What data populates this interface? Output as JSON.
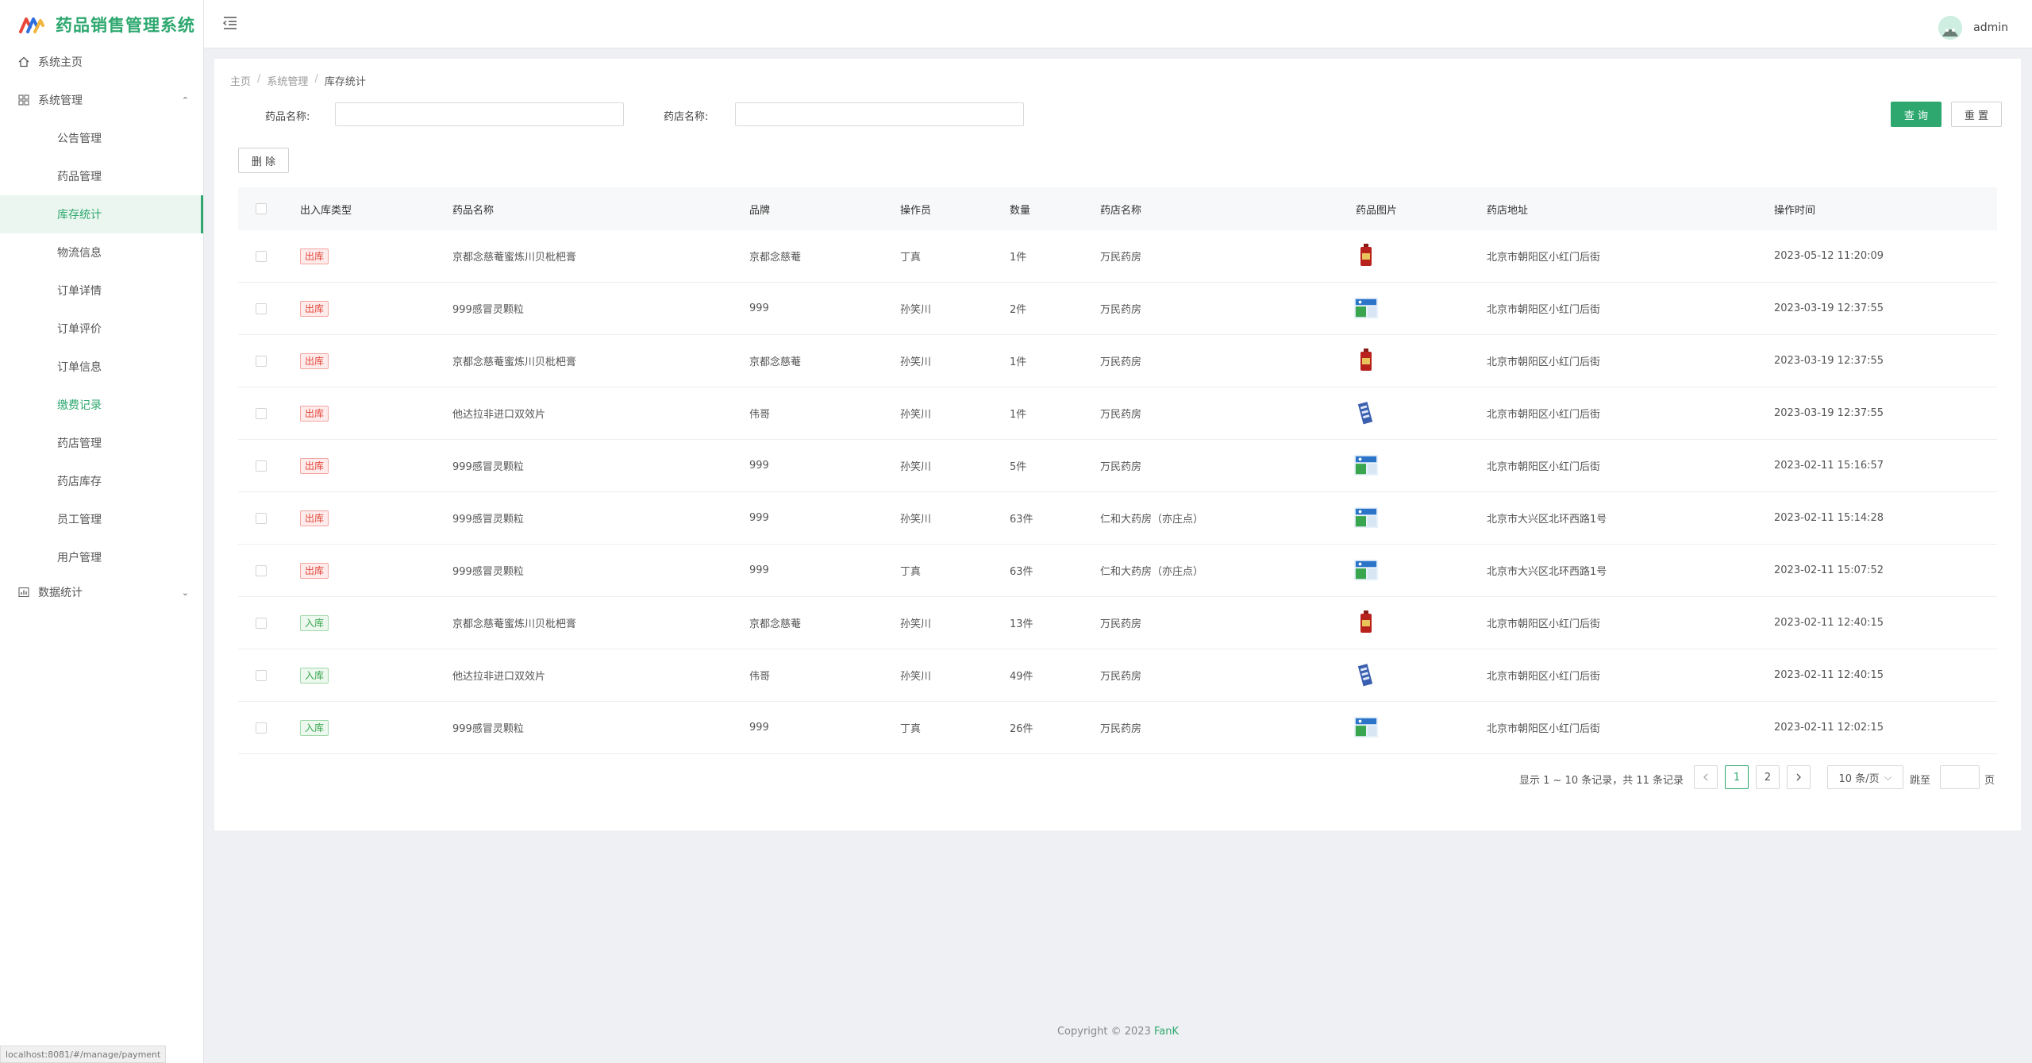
{
  "app": {
    "title": "药品销售管理系统",
    "brand_color": "#2ea86f"
  },
  "sidebar": {
    "home": "系统主页",
    "system": "系统管理",
    "sub_items": [
      "公告管理",
      "药品管理",
      "库存统计",
      "物流信息",
      "订单详情",
      "订单评价",
      "订单信息",
      "缴费记录",
      "药店管理",
      "药店库存",
      "员工管理",
      "用户管理"
    ],
    "active_item": "库存统计",
    "stats": "数据统计"
  },
  "header": {
    "username": "admin"
  },
  "breadcrumb": [
    "主页",
    "系统管理",
    "库存统计"
  ],
  "search": {
    "drug_label": "药品名称:",
    "drug_value": "",
    "store_label": "药店名称:",
    "store_value": "",
    "query_btn": "查 询",
    "reset_btn": "重 置"
  },
  "toolbar": {
    "delete_btn": "删 除"
  },
  "table": {
    "columns": [
      "出入库类型",
      "药品名称",
      "品牌",
      "操作员",
      "数量",
      "药店名称",
      "药品图片",
      "药店地址",
      "操作时间"
    ],
    "rows": [
      {
        "type": "出库",
        "kind": "out",
        "drug": "京都念慈菴蜜炼川贝枇杷膏",
        "brand": "京都念慈菴",
        "operator": "丁真",
        "qty": "1件",
        "store": "万民药房",
        "img": "red-bottle-icon",
        "address": "北京市朝阳区小红门后街",
        "time": "2023-05-12 11:20:09"
      },
      {
        "type": "出库",
        "kind": "out",
        "drug": "999感冒灵颗粒",
        "brand": "999",
        "operator": "孙笑川",
        "qty": "2件",
        "store": "万民药房",
        "img": "medicine-box-icon",
        "address": "北京市朝阳区小红门后街",
        "time": "2023-03-19 12:37:55"
      },
      {
        "type": "出库",
        "kind": "out",
        "drug": "京都念慈菴蜜炼川贝枇杷膏",
        "brand": "京都念慈菴",
        "operator": "孙笑川",
        "qty": "1件",
        "store": "万民药房",
        "img": "red-bottle-icon",
        "address": "北京市朝阳区小红门后街",
        "time": "2023-03-19 12:37:55"
      },
      {
        "type": "出库",
        "kind": "out",
        "drug": "他达拉非进口双效片",
        "brand": "伟哥",
        "operator": "孙笑川",
        "qty": "1件",
        "store": "万民药房",
        "img": "blue-pack-icon",
        "address": "北京市朝阳区小红门后街",
        "time": "2023-03-19 12:37:55"
      },
      {
        "type": "出库",
        "kind": "out",
        "drug": "999感冒灵颗粒",
        "brand": "999",
        "operator": "孙笑川",
        "qty": "5件",
        "store": "万民药房",
        "img": "medicine-box-icon",
        "address": "北京市朝阳区小红门后街",
        "time": "2023-02-11 15:16:57"
      },
      {
        "type": "出库",
        "kind": "out",
        "drug": "999感冒灵颗粒",
        "brand": "999",
        "operator": "孙笑川",
        "qty": "63件",
        "store": "仁和大药房（亦庄点）",
        "img": "medicine-box-icon",
        "address": "北京市大兴区北环西路1号",
        "time": "2023-02-11 15:14:28"
      },
      {
        "type": "出库",
        "kind": "out",
        "drug": "999感冒灵颗粒",
        "brand": "999",
        "operator": "丁真",
        "qty": "63件",
        "store": "仁和大药房（亦庄点）",
        "img": "medicine-box-icon",
        "address": "北京市大兴区北环西路1号",
        "time": "2023-02-11 15:07:52"
      },
      {
        "type": "入库",
        "kind": "in",
        "drug": "京都念慈菴蜜炼川贝枇杷膏",
        "brand": "京都念慈菴",
        "operator": "孙笑川",
        "qty": "13件",
        "store": "万民药房",
        "img": "red-bottle-icon",
        "address": "北京市朝阳区小红门后街",
        "time": "2023-02-11 12:40:15"
      },
      {
        "type": "入库",
        "kind": "in",
        "drug": "他达拉非进口双效片",
        "brand": "伟哥",
        "operator": "孙笑川",
        "qty": "49件",
        "store": "万民药房",
        "img": "blue-pack-icon",
        "address": "北京市朝阳区小红门后街",
        "time": "2023-02-11 12:40:15"
      },
      {
        "type": "入库",
        "kind": "in",
        "drug": "999感冒灵颗粒",
        "brand": "999",
        "operator": "丁真",
        "qty": "26件",
        "store": "万民药房",
        "img": "medicine-box-icon",
        "address": "北京市朝阳区小红门后街",
        "time": "2023-02-11 12:02:15"
      }
    ]
  },
  "pagination": {
    "summary": "显示 1 ~ 10 条记录，共 11 条记录",
    "pages": [
      "1",
      "2"
    ],
    "current": "1",
    "page_size": "10 条/页",
    "jump_label": "跳至",
    "page_unit": "页"
  },
  "footer": {
    "copyright": "Copyright © 2023 ",
    "author": "FanK"
  },
  "status_url": "localhost:8081/#/manage/payment"
}
